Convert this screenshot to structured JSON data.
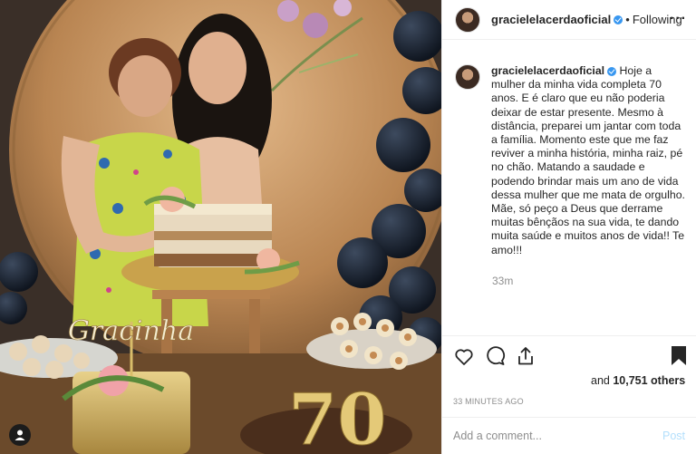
{
  "post": {
    "username": "gracielelacerdaoficial",
    "verified": true,
    "separator": "•",
    "follow_state": "Following",
    "more_label": "···",
    "caption": "Hoje a mulher da minha vida completa 70 anos. E é claro que eu não poderia deixar de estar presente. Mesmo à distância, preparei um jantar com toda a família. Momento este que me faz reviver a minha história, minha raiz, pé no chão. Matando a saudade e podendo brindar mais um ano de vida dessa mulher que me mata de orgulho. Mãe, só peço a Deus que derrame muitas bênçãos na sua vida, te dando muita saúde e muitos anos de vida!! Te amo!!!",
    "caption_time": "33m",
    "likes_prefix": "and ",
    "likes_count": "10,751 others",
    "timestamp": "33 MINUTES AGO"
  },
  "photo": {
    "cake_topper_text": "Gracinha",
    "cake_number": "70"
  },
  "comment": {
    "placeholder": "Add a comment...",
    "post_label": "Post"
  },
  "icons": {
    "like": "heart-icon",
    "comment": "comment-icon",
    "share": "share-icon",
    "save": "bookmark-icon",
    "user": "user-icon",
    "more": "more-icon"
  },
  "colors": {
    "verified": "#3897f0",
    "post_disabled": "#b2dffc",
    "muted": "#8e8e8e"
  }
}
